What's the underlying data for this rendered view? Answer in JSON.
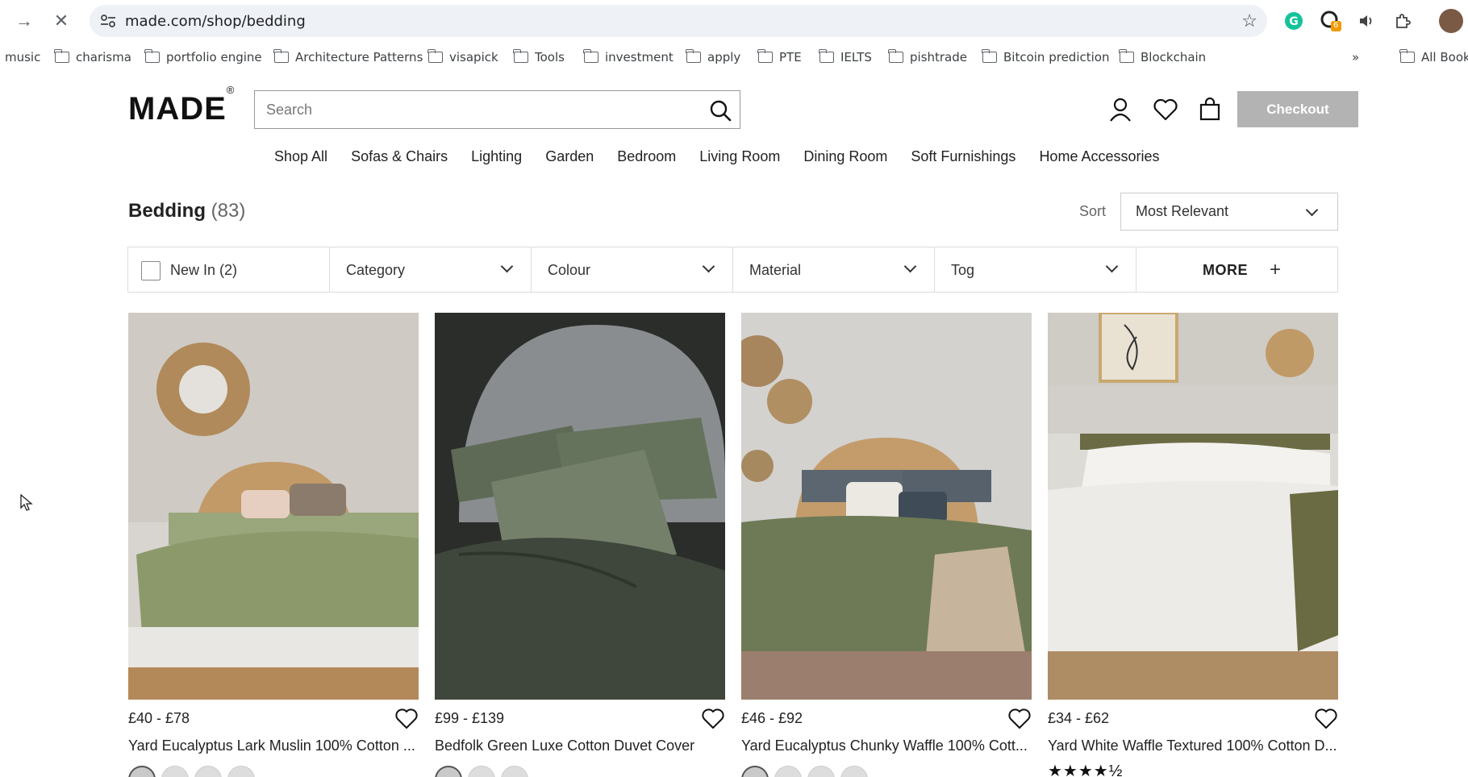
{
  "browser": {
    "url": "made.com/shop/bedding",
    "bookmarks": [
      "music",
      "charisma",
      "portfolio engine",
      "Architecture Patterns",
      "visapick",
      "Tools",
      "investment",
      "apply",
      "PTE",
      "IELTS",
      "pishtrade",
      "Bitcoin prediction",
      "Blockchain"
    ],
    "all_bookmarks": "All Book",
    "overflow": "»",
    "extension_badge": "6"
  },
  "site": {
    "logo": "MADE",
    "logo_mark": "®",
    "search_placeholder": "Search",
    "checkout": "Checkout",
    "nav": [
      "Shop All",
      "Sofas & Chairs",
      "Lighting",
      "Garden",
      "Bedroom",
      "Living Room",
      "Dining Room",
      "Soft Furnishings",
      "Home Accessories"
    ]
  },
  "listing": {
    "title": "Bedding",
    "count": "(83)",
    "sort_label": "Sort",
    "sort_value": "Most Relevant",
    "filters": {
      "new_in": "New In (2)",
      "category": "Category",
      "colour": "Colour",
      "material": "Material",
      "tog": "Tog",
      "more": "MORE",
      "more_icon": "+"
    }
  },
  "products": [
    {
      "price": "£40 - £78",
      "name": "Yard Eucalyptus Lark Muslin 100% Cotton ...",
      "swatches": 4
    },
    {
      "price": "£99 - £139",
      "name": "Bedfolk Green Luxe Cotton Duvet Cover",
      "swatches": 3
    },
    {
      "price": "£46 - £92",
      "name": "Yard Eucalyptus Chunky Waffle 100% Cott...",
      "swatches": 4
    },
    {
      "price": "£34 - £62",
      "name": "Yard White Waffle Textured 100% Cotton D...",
      "rating": 4.5,
      "stars": "★★★★½"
    }
  ]
}
